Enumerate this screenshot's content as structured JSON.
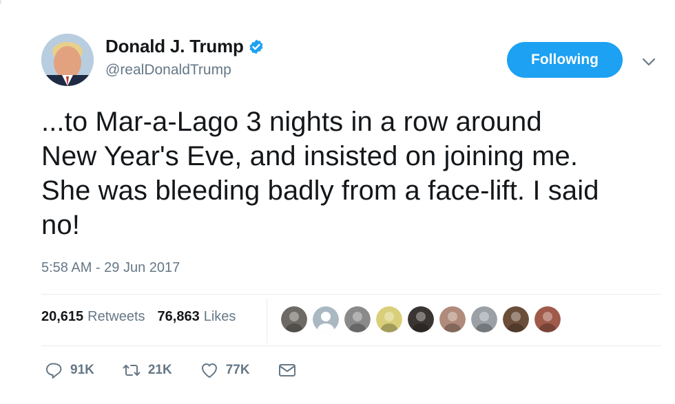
{
  "user": {
    "display_name": "Donald J. Trump",
    "handle": "@realDonaldTrump",
    "verified": true,
    "avatar_icon": "profile-photo"
  },
  "follow_button": {
    "label": "Following",
    "color": "#1da1f2"
  },
  "menu": {
    "icon": "chevron-down-icon"
  },
  "tweet": {
    "text": "...to Mar-a-Lago 3 nights in a row around\nNew Year's Eve, and insisted on joining me.\nShe was bleeding badly from a face-lift. I said\nno!",
    "timestamp": "5:58 AM - 29 Jun 2017"
  },
  "stats": {
    "retweets_count": "20,615",
    "retweets_label": "Retweets",
    "likes_count": "76,863",
    "likes_label": "Likes"
  },
  "likers": [
    {
      "icon": "raccoon-avatar",
      "color": "#6d6a66"
    },
    {
      "icon": "default-avatar",
      "color": "#aab8c2"
    },
    {
      "icon": "cat-avatar",
      "color": "#8a8a8a"
    },
    {
      "icon": "cartoon-avatar",
      "color": "#d9cf7a"
    },
    {
      "icon": "person-avatar",
      "color": "#3a3532"
    },
    {
      "icon": "person-avatar",
      "color": "#b08a7a"
    },
    {
      "icon": "landscape-avatar",
      "color": "#9aa0a6"
    },
    {
      "icon": "group-avatar",
      "color": "#6b4e3a"
    },
    {
      "icon": "people-avatar",
      "color": "#a05a4a"
    }
  ],
  "actions": {
    "reply_count": "91K",
    "retweet_count": "21K",
    "like_count": "77K",
    "reply_icon": "reply-icon",
    "retweet_icon": "retweet-icon",
    "like_icon": "heart-icon",
    "message_icon": "envelope-icon"
  },
  "colors": {
    "text": "#14171a",
    "muted": "#657786",
    "accent": "#1da1f2",
    "divider": "#e6ecf0"
  }
}
